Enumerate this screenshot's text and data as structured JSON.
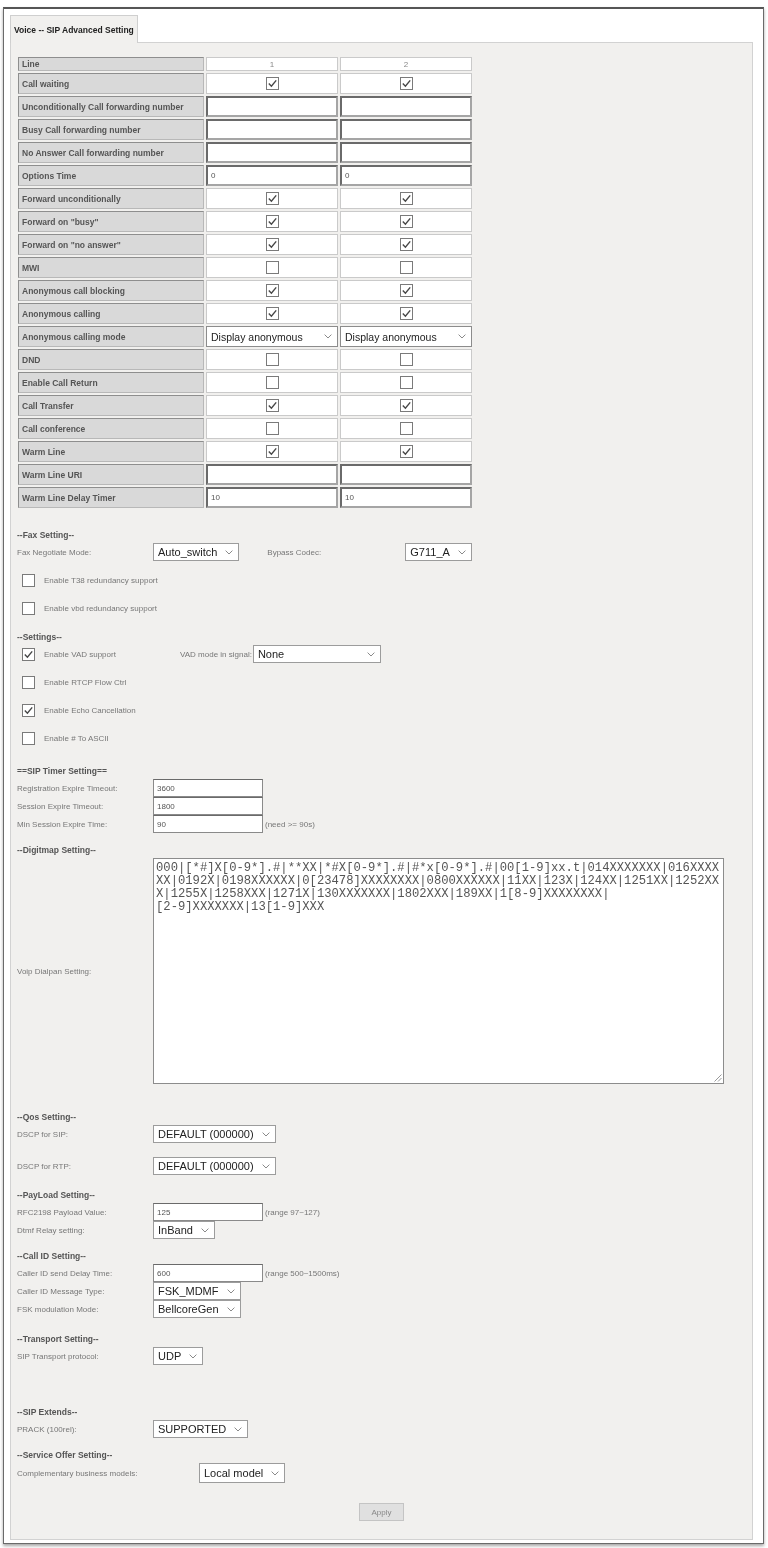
{
  "tabs": [
    {
      "label": "Voice -- SIP Advanced Setting",
      "selected": true
    }
  ],
  "line_table": {
    "header": {
      "label": "Line",
      "columns": [
        "1",
        "2"
      ]
    },
    "rows": [
      {
        "label": "Call waiting",
        "cells": [
          {
            "kind": "checkbox",
            "checked": true
          },
          {
            "kind": "checkbox",
            "checked": true
          }
        ]
      },
      {
        "label": "Unconditionally Call forwarding number",
        "cells": [
          {
            "kind": "input"
          },
          {
            "kind": "input"
          }
        ]
      },
      {
        "label": "Busy Call forwarding number",
        "cells": [
          {
            "kind": "input"
          },
          {
            "kind": "input"
          }
        ]
      },
      {
        "label": "No Answer Call forwarding number",
        "cells": [
          {
            "kind": "input"
          },
          {
            "kind": "input"
          }
        ]
      },
      {
        "label": "Options Time",
        "cells": [
          {
            "kind": "input",
            "value": "0"
          },
          {
            "kind": "input",
            "value": "0"
          }
        ]
      },
      {
        "label": "Forward unconditionally",
        "cells": [
          {
            "kind": "checkbox",
            "checked": true
          },
          {
            "kind": "checkbox",
            "checked": true
          }
        ]
      },
      {
        "label": "Forward on \"busy\"",
        "cells": [
          {
            "kind": "checkbox",
            "checked": true
          },
          {
            "kind": "checkbox",
            "checked": true
          }
        ]
      },
      {
        "label": "Forward on \"no answer\"",
        "cells": [
          {
            "kind": "checkbox",
            "checked": true
          },
          {
            "kind": "checkbox",
            "checked": true
          }
        ]
      },
      {
        "label": "MWI",
        "cells": [
          {
            "kind": "checkbox",
            "checked": false
          },
          {
            "kind": "checkbox",
            "checked": false
          }
        ]
      },
      {
        "label": "Anonymous call blocking",
        "cells": [
          {
            "kind": "checkbox",
            "checked": true
          },
          {
            "kind": "checkbox",
            "checked": true
          }
        ]
      },
      {
        "label": "Anonymous calling",
        "cells": [
          {
            "kind": "checkbox",
            "checked": true
          },
          {
            "kind": "checkbox",
            "checked": true
          }
        ]
      },
      {
        "label": "Anonymous calling mode",
        "cells": [
          {
            "kind": "select",
            "value": "Display anonymous"
          },
          {
            "kind": "select",
            "value": "Display anonymous"
          }
        ]
      },
      {
        "label": "DND",
        "cells": [
          {
            "kind": "checkbox",
            "checked": false
          },
          {
            "kind": "checkbox",
            "checked": false
          }
        ]
      },
      {
        "label": "Enable Call Return",
        "cells": [
          {
            "kind": "checkbox",
            "checked": false
          },
          {
            "kind": "checkbox",
            "checked": false
          }
        ]
      },
      {
        "label": "Call Transfer",
        "cells": [
          {
            "kind": "checkbox",
            "checked": true
          },
          {
            "kind": "checkbox",
            "checked": true
          }
        ]
      },
      {
        "label": "Call conference",
        "cells": [
          {
            "kind": "checkbox",
            "checked": false
          },
          {
            "kind": "checkbox",
            "checked": false
          }
        ]
      },
      {
        "label": "Warm Line",
        "cells": [
          {
            "kind": "checkbox",
            "checked": true
          },
          {
            "kind": "checkbox",
            "checked": true
          }
        ]
      },
      {
        "label": "Warm Line URI",
        "cells": [
          {
            "kind": "input"
          },
          {
            "kind": "input"
          }
        ]
      },
      {
        "label": "Warm Line Delay Timer",
        "cells": [
          {
            "kind": "input",
            "value": "10"
          },
          {
            "kind": "input",
            "value": "10"
          }
        ]
      }
    ]
  },
  "sections": [
    {
      "title": "--Fax Setting--",
      "items": [
        {
          "kind": "select",
          "label": "Fax Negotiate Mode:",
          "value": "Auto_switch",
          "extra": {
            "label": "Bypass Codec:",
            "value": "G711_A"
          }
        },
        {
          "kind": "checkbox",
          "label": "Enable T38 redundancy support",
          "checked": false
        },
        {
          "kind": "checkbox",
          "label": "Enable vbd redundancy support",
          "checked": false
        }
      ]
    },
    {
      "title": "--Settings--",
      "items": [
        {
          "kind": "checkbox",
          "label": "Enable VAD support",
          "checked": true,
          "extra": {
            "label": "VAD mode in signal:",
            "value": "None"
          }
        },
        {
          "kind": "checkbox",
          "label": "Enable RTCP Flow Ctrl",
          "checked": false
        },
        {
          "kind": "checkbox",
          "label": "Enable Echo Cancellation",
          "checked": true
        },
        {
          "kind": "checkbox",
          "label": "Enable # To ASCII",
          "checked": false
        }
      ]
    },
    {
      "title": "==SIP Timer Setting==",
      "items": [
        {
          "kind": "input",
          "label": "Registration Expire Timeout:",
          "value": "3600"
        },
        {
          "kind": "input",
          "label": "Session Expire Timeout:",
          "value": "1800"
        },
        {
          "kind": "input",
          "label": "Min Session Expire Time:",
          "value": "90",
          "note": "(need >= 90s)"
        }
      ]
    },
    {
      "title": "--Digitmap Setting--",
      "items": [
        {
          "kind": "textarea",
          "label": "Voip Dialpan Setting:",
          "value": "000|[*#]X[0-9*].#|**XX|*#X[0-9*].#|#*x[0-9*].#|00[1-9]xx.t|014XXXXXXX|016XXXXXX|0192X|0198XXXXXX|0[23478]XXXXXXXX|0800XXXXXX|11XX|123X|124XX|1251XX|1252XXX|1255X|1258XXX|1271X|130XXXXXXX|1802XXX|189XX|1[8-9]XXXXXXXX|\n[2-9]XXXXXXX|13[1-9]XXX"
        }
      ]
    },
    {
      "title": "--Qos Setting--",
      "items": [
        {
          "kind": "select",
          "label": "DSCP for SIP:",
          "value": "DEFAULT (000000)"
        },
        {
          "kind": "select",
          "label": "DSCP for RTP:",
          "value": "DEFAULT (000000)"
        }
      ]
    },
    {
      "title": "--PayLoad Setting--",
      "items": [
        {
          "kind": "input",
          "label": "RFC2198 Payload Value:",
          "value": "125",
          "note": "(range 97~127)"
        },
        {
          "kind": "select",
          "label": "Dtmf Relay setting:",
          "value": "InBand"
        }
      ]
    },
    {
      "title": "--Call ID Setting--",
      "items": [
        {
          "kind": "input",
          "label": "Caller ID send Delay Time:",
          "value": "600",
          "note": "(range 500~1500ms)"
        },
        {
          "kind": "select",
          "label": "Caller ID Message Type:",
          "value": "FSK_MDMF"
        },
        {
          "kind": "select",
          "label": "FSK modulation Mode:",
          "value": "BellcoreGen"
        }
      ]
    },
    {
      "title": "--Transport Setting--",
      "items": [
        {
          "kind": "select",
          "label": "SIP Transport protocol:",
          "value": "UDP"
        }
      ]
    },
    {
      "title": "--SIP Extends--",
      "items": [
        {
          "kind": "select",
          "label": "PRACK (100rel):",
          "value": "SUPPORTED"
        }
      ]
    },
    {
      "title": "--Service Offer Setting--",
      "items": [
        {
          "kind": "select",
          "label": "Complementary business models:",
          "value": "Local model"
        }
      ]
    }
  ],
  "apply_button": {
    "label": "Apply"
  }
}
